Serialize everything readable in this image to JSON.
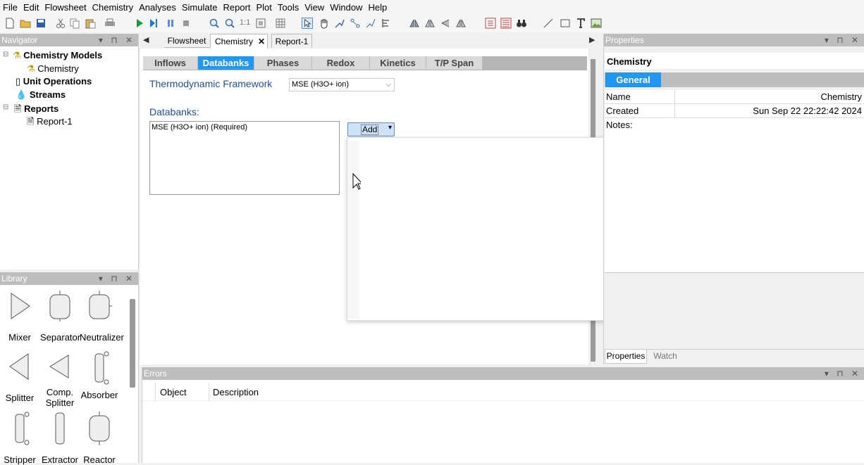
{
  "menu": [
    "File",
    "Edit",
    "Flowsheet",
    "Chemistry",
    "Analyses",
    "Simulate",
    "Report",
    "Plot",
    "Tools",
    "View",
    "Window",
    "Help"
  ],
  "toolbar": {
    "zoom_label": "1:1"
  },
  "navigator": {
    "title": "Navigator",
    "items": [
      {
        "label": "Chemistry Models",
        "bold": true
      },
      {
        "label": "Chemistry",
        "bold": false
      },
      {
        "label": "Unit Operations",
        "bold": true
      },
      {
        "label": "Streams",
        "bold": true
      },
      {
        "label": "Reports",
        "bold": true
      },
      {
        "label": "Report-1",
        "bold": false
      }
    ]
  },
  "library": {
    "title": "Library",
    "items": [
      {
        "label": "Mixer",
        "icon": "mixer-icon"
      },
      {
        "label": "Separator",
        "icon": "separator-icon"
      },
      {
        "label": "Neutralizer",
        "icon": "neutralizer-icon"
      },
      {
        "label": "Splitter",
        "icon": "splitter-icon"
      },
      {
        "label": "Comp. Splitter",
        "icon": "comp-splitter-icon"
      },
      {
        "label": "Absorber",
        "icon": "absorber-icon"
      },
      {
        "label": "Stripper",
        "icon": "stripper-icon"
      },
      {
        "label": "Extractor",
        "icon": "extractor-icon"
      },
      {
        "label": "Reactor",
        "icon": "reactor-icon"
      }
    ]
  },
  "doc_tabs": [
    "Flowsheet",
    "Chemistry",
    "Report-1"
  ],
  "sub_tabs": [
    "Inflows",
    "Databanks",
    "Phases",
    "Redox",
    "Kinetics",
    "T/P Span"
  ],
  "thermo": {
    "label": "Thermodynamic Framework",
    "value": "MSE (H3O+ ion)"
  },
  "databanks": {
    "label": "Databanks:",
    "items": [
      "MSE (H3O+ ion) (Required)"
    ],
    "add_label": "Add"
  },
  "properties": {
    "title": "Properties",
    "heading": "Chemistry",
    "tab": "General",
    "rows": [
      {
        "key": "Name",
        "value": "Chemistry"
      },
      {
        "key": "Created",
        "value": "Sun Sep 22 22:22:42 2024"
      },
      {
        "key": "Notes:",
        "value": ""
      }
    ],
    "bottom_tabs": [
      "Properties",
      "Watch"
    ]
  },
  "errors": {
    "title": "Errors",
    "columns": [
      "Object",
      "Description"
    ]
  },
  "colors": {
    "accent": "#2196f3",
    "header_gray": "#bdbdbd",
    "link_blue": "#1f4e9a"
  }
}
